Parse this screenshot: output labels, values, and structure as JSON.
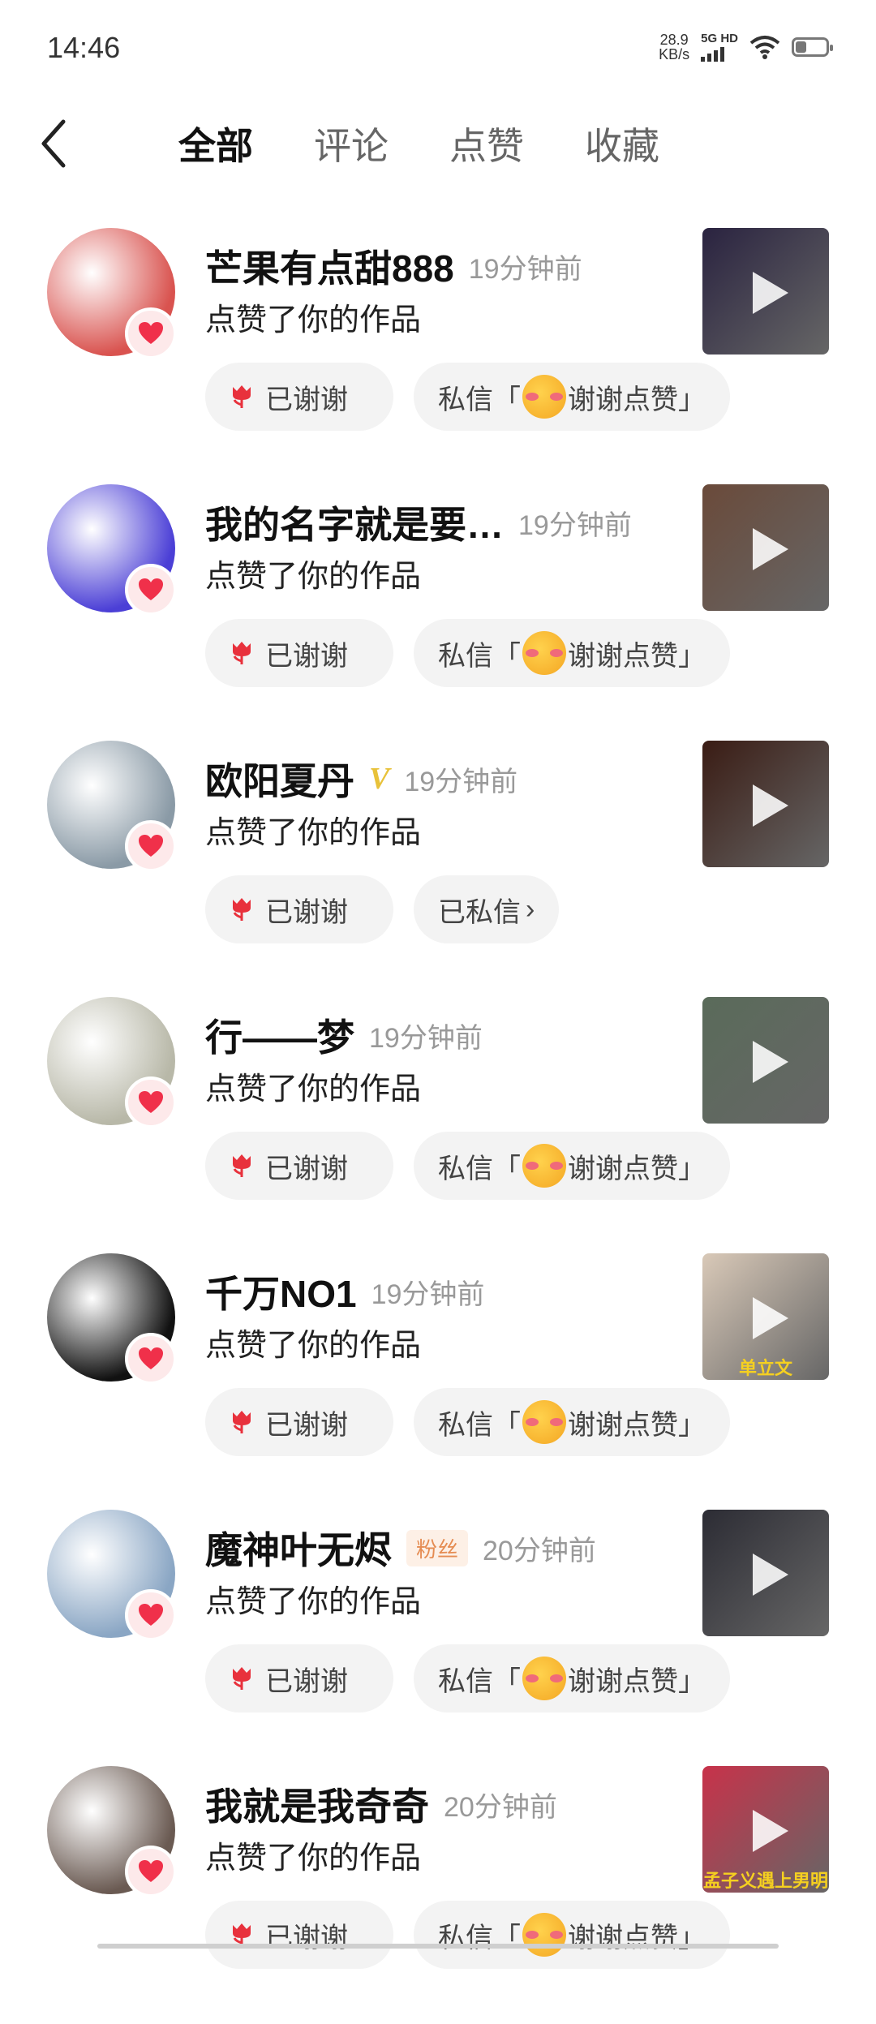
{
  "status_bar": {
    "time": "14:46",
    "speed_value": "28.9",
    "speed_unit": "KB/s",
    "network": "5G HD",
    "battery_level": 0.35
  },
  "header": {
    "back_icon": "chevron-left-icon",
    "tabs": [
      {
        "label": "全部",
        "active": true
      },
      {
        "label": "评论",
        "active": false
      },
      {
        "label": "点赞",
        "active": false
      },
      {
        "label": "收藏",
        "active": false
      }
    ]
  },
  "items": [
    {
      "name": "芒果有点甜888",
      "time": "19分钟前",
      "action": "点赞了你的作品",
      "thanks": "已谢谢",
      "msg_prefix": "私信「",
      "msg_suffix": "谢谢点赞」",
      "badge": "",
      "avatar_color": "#d9534f",
      "thumb_color": "#2a2340"
    },
    {
      "name": "我的名字就是要…",
      "time": "19分钟前",
      "action": "点赞了你的作品",
      "thanks": "已谢谢",
      "msg_prefix": "私信「",
      "msg_suffix": "谢谢点赞」",
      "badge": "",
      "avatar_color": "#4b3fd6",
      "thumb_color": "#6a4a3a"
    },
    {
      "name": "欧阳夏丹",
      "time": "19分钟前",
      "action": "点赞了你的作品",
      "thanks": "已谢谢",
      "msg_label": "已私信",
      "badge": "V",
      "avatar_color": "#8a9aa6",
      "thumb_color": "#3a1c14"
    },
    {
      "name": "行——梦",
      "time": "19分钟前",
      "action": "点赞了你的作品",
      "thanks": "已谢谢",
      "msg_prefix": "私信「",
      "msg_suffix": "谢谢点赞」",
      "badge": "",
      "avatar_color": "#b8b8a8",
      "thumb_color": "#5a6b5a"
    },
    {
      "name": "千万NO1",
      "time": "19分钟前",
      "action": "点赞了你的作品",
      "thanks": "已谢谢",
      "msg_prefix": "私信「",
      "msg_suffix": "谢谢点赞」",
      "badge": "",
      "avatar_color": "#111111",
      "thumb_color": "#d9c9b8",
      "thumb_caption": "单立文"
    },
    {
      "name": "魔神叶无烬",
      "time": "20分钟前",
      "action": "点赞了你的作品",
      "thanks": "已谢谢",
      "msg_prefix": "私信「",
      "msg_suffix": "谢谢点赞」",
      "badge": "粉丝",
      "avatar_color": "#8aa6c4",
      "thumb_color": "#2c2c34"
    },
    {
      "name": "我就是我奇奇",
      "time": "20分钟前",
      "action": "点赞了你的作品",
      "thanks": "已谢谢",
      "msg_prefix": "私信「",
      "msg_suffix": "谢谢点赞」",
      "badge": "",
      "avatar_color": "#6a5a52",
      "thumb_color": "#c8324a",
      "thumb_caption": "孟子义遇上男明"
    }
  ]
}
